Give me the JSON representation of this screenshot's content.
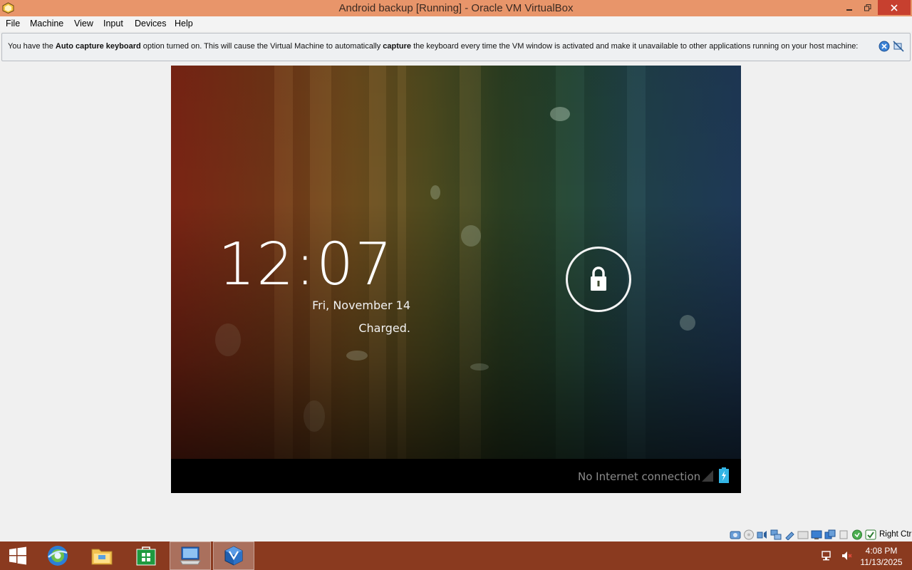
{
  "window": {
    "title": "Android backup [Running] - Oracle VM VirtualBox"
  },
  "menu": {
    "items": [
      "File",
      "Machine",
      "View",
      "Input",
      "Devices",
      "Help"
    ]
  },
  "notice": {
    "part1": "You have the ",
    "bold1": "Auto capture keyboard",
    "part2": " option turned on. This will cause the Virtual Machine to automatically ",
    "bold2": "capture",
    "part3": " the keyboard every time the VM window is activated and make it unavailable to other applications running on your host machine:"
  },
  "android": {
    "time": "12:07",
    "date": "Fri, November 14",
    "battery_status": "Charged.",
    "network_status": "No Internet connection"
  },
  "vm_status": {
    "indicators": [
      "hard-disk-icon",
      "optical-drive-icon",
      "audio-icon",
      "network-icon",
      "usb-icon",
      "shared-folders-icon",
      "display-icon",
      "video-capture-icon",
      "cpu-icon",
      "mouse-integration-icon",
      "host-key-icon"
    ],
    "host_key": "Right Ctrl"
  },
  "taskbar": {
    "apps": [
      "start-icon",
      "browser-icon",
      "file-explorer-icon",
      "store-icon",
      "remote-desktop-icon",
      "virtualbox-icon"
    ],
    "time": "4:08 PM",
    "date": "11/13/2025"
  },
  "colors": {
    "titlebar": "#e8956a",
    "close_button": "#c7402f",
    "taskbar": "#8a3a1f",
    "android_statusbar": "#000000"
  }
}
